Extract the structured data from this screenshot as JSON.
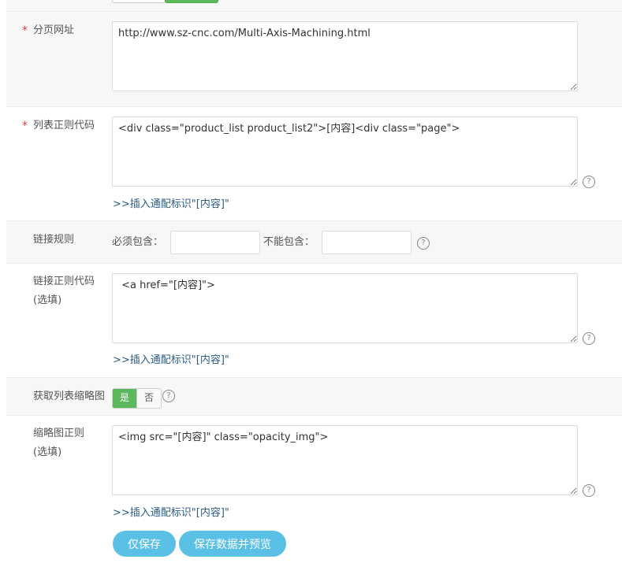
{
  "fields": {
    "page_url": {
      "label": "分页网址",
      "value": "http://www.sz-cnc.com/Multi-Axis-Machining.html"
    },
    "list_regex": {
      "label": "列表正则代码",
      "value": "<div class=\"product_list product_list2\">[内容]<div class=\"page\">",
      "insert_link": ">>插入通配标识\"[内容]\""
    },
    "link_rules": {
      "label": "链接规则",
      "must_include_label": "必须包含：",
      "must_include_value": "",
      "must_exclude_label": "不能包含：",
      "must_exclude_value": ""
    },
    "link_regex": {
      "label_line1": "链接正则代码",
      "label_line2": "(选填)",
      "value": " <a href=\"[内容]\">",
      "insert_link": ">>插入通配标识\"[内容]\""
    },
    "thumbnail": {
      "label": "获取列表缩略图",
      "yes_label": "是",
      "no_label": "否",
      "selected": "是"
    },
    "thumb_regex": {
      "label_line1": "缩略图正则",
      "label_line2": "(选填)",
      "value": "<img src=\"[内容]\" class=\"opacity_img\">",
      "insert_link": ">>插入通配标识\"[内容]\""
    }
  },
  "required_mark": "*",
  "help_glyph": "?",
  "buttons": {
    "save_only": "仅保存",
    "save_preview": "保存数据并预览"
  },
  "colors": {
    "accent_button": "#5bc0e6",
    "toggle_active": "#5cb85c",
    "required": "#e4393c",
    "link": "#2a5b8a"
  }
}
